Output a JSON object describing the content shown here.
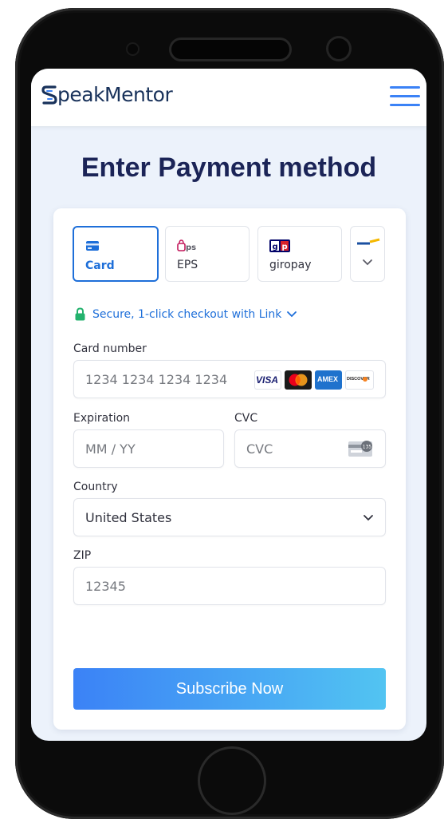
{
  "app": {
    "logo_text": "peakMentor",
    "logo_icon": "s-stripes-logo"
  },
  "page": {
    "title": "Enter Payment method"
  },
  "payment_tabs": [
    {
      "label": "Card",
      "icon": "credit-card-icon",
      "active": true
    },
    {
      "label": "EPS",
      "icon": "eps-logo-icon",
      "active": false
    },
    {
      "label": "giropay",
      "icon": "giropay-logo-icon",
      "active": false
    },
    {
      "label": "",
      "icon": "chevron-down-icon",
      "active": false
    }
  ],
  "link": {
    "label": "Secure, 1-click checkout with Link"
  },
  "form": {
    "card_number": {
      "label": "Card number",
      "placeholder": "1234 1234 1234 1234"
    },
    "card_brands": [
      "VISA",
      "mastercard",
      "AMEX",
      "DISCOVER"
    ],
    "expiration": {
      "label": "Expiration",
      "placeholder": "MM / YY"
    },
    "cvc": {
      "label": "CVC",
      "placeholder": "CVC",
      "badge": "135"
    },
    "country": {
      "label": "Country",
      "value": "United States"
    },
    "zip": {
      "label": "ZIP",
      "placeholder": "12345"
    }
  },
  "submit": {
    "label": "Subscribe Now"
  },
  "colors": {
    "accent": "#1e6fd9",
    "title": "#1b2457",
    "button_start": "#3b82f6",
    "button_end": "#52c4f2"
  }
}
